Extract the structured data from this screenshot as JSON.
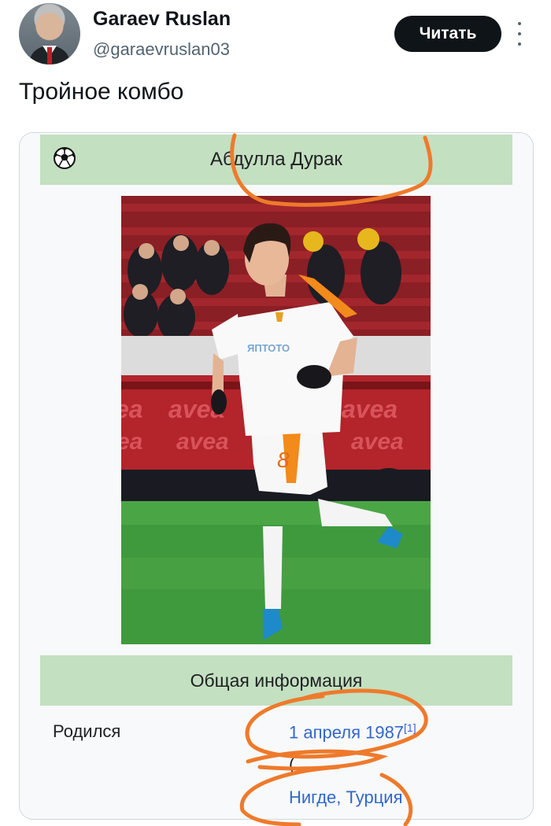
{
  "tweet": {
    "author_name": "Garaev Ruslan",
    "author_handle": "@garaevruslan03",
    "follow_label": "Читать",
    "text": "Тройное комбо"
  },
  "infobox": {
    "title": "Абдулла Дурак",
    "section_title": "Общая информация",
    "born_label": "Родился",
    "born_date": "1 апреля 1987",
    "born_date_ref": "[1]",
    "born_place_prefix": "Нигде, ",
    "born_place_country": "Турция"
  },
  "photo": {
    "shirt_number": "8",
    "sponsor_text": "avea"
  },
  "colors": {
    "infobox_header": "#c3e0c1",
    "link": "#3366cc",
    "annotation": "#ee7a2b",
    "follow_button": "#0f1419"
  }
}
